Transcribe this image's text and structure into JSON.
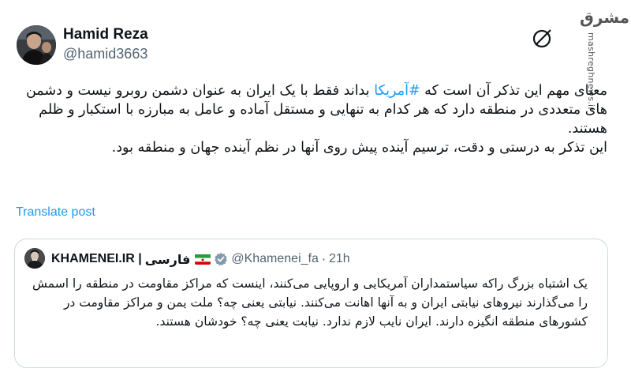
{
  "author": {
    "name": "Hamid Reza",
    "handle": "@hamid3663"
  },
  "watermark": {
    "logo": "مشرق",
    "url": "mashreghnews.ir"
  },
  "tweet": {
    "text_before_hashtag": "معنای مهم این تذکر آن است که ",
    "hashtag": "#آمریکا",
    "text_after_hashtag": " بداند فقط با یک ایران به عنوان دشمن روبرو نیست و دشمن های متعددی در منطقه دارد که هر کدام به تنهایی و مستقل آماده و عامل به مبارزه با استکبار و ظلم هستند.",
    "paragraph_2": "این تذکر به درستی و دقت، ترسیم آینده پیش روی آنها در نظم آینده جهان و منطقه بود."
  },
  "translate_label": "Translate post",
  "quoted": {
    "name": "KHAMENEI.IR |",
    "name_fa": "فارسی",
    "handle": "@Khamenei_fa",
    "separator": "·",
    "time": "21h",
    "text": "یک اشتباه بزرگ راکه سیاستمداران آمریکایی و اروپایی می‌کنند، اینست که مراکز مقاومت در منطقه را اسمش را می‌گذارند نیروهای نیابتی ایران و به آنها اهانت می‌کنند. نیابتی یعنی چه؟ ملت یمن و مراکز مقاومت در کشورهای منطقه انگیزه دارند. ایران نایب لازم ندارد. نیابت یعنی چه؟ خودشان هستند."
  },
  "icons": {
    "grok": "grok-icon",
    "flag": "iran-flag-icon",
    "verified": "verified-badge-icon"
  },
  "colors": {
    "link": "#1d9bf0",
    "secondary_text": "#536471",
    "border": "#cfd9de",
    "verified_gray": "#829aab"
  }
}
